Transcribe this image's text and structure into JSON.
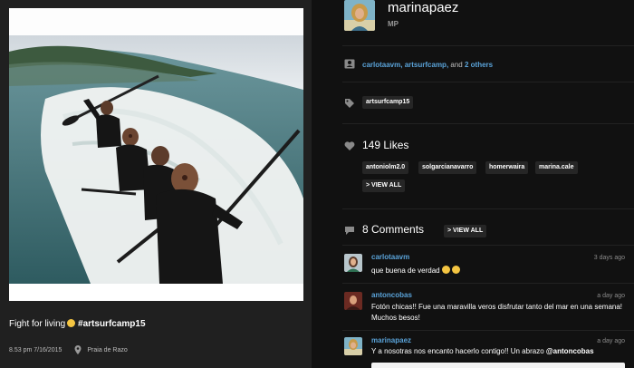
{
  "post": {
    "caption_text": "Fight for living",
    "caption_hashtag": "#artsurfcamp15",
    "datetime": "8.53 pm 7/16/2015",
    "location": "Praia de Razo"
  },
  "author": {
    "username": "marinapaez",
    "initials": "MP"
  },
  "with": {
    "user1": "carlotaavm,",
    "user2": "artsurfcamp,",
    "and": "and",
    "others": "2 others"
  },
  "tags": [
    "artsurfcamp15"
  ],
  "likes": {
    "title": "149 Likes",
    "users": [
      "antoniolm2.0",
      "solgarcianavarro",
      "homerwaira",
      "marina.cale"
    ],
    "view_all": "> VIEW ALL"
  },
  "comments": {
    "title": "8 Comments",
    "view_all": "> VIEW ALL",
    "items": [
      {
        "user": "carlotaavm",
        "time": "3 days ago",
        "text": "que buena de verdad"
      },
      {
        "user": "antoncobas",
        "time": "a day ago",
        "text": "Fotón chicas!! Fue una maravilla veros disfrutar tanto del mar en una semana! Muchos besos!"
      },
      {
        "user": "marinapaez",
        "time": "a day ago",
        "text": "Y a nosotras nos encanto hacerlo contigo!! Un abrazo",
        "mention": "@antoncobas"
      }
    ]
  },
  "colors": {
    "link": "#5aa3d9",
    "background": "#111111",
    "pill": "#262626"
  },
  "icons": [
    "location-pin-icon",
    "with-person-icon",
    "tag-icon",
    "heart-icon",
    "comment-bubble-icon",
    "emoji-icon"
  ]
}
